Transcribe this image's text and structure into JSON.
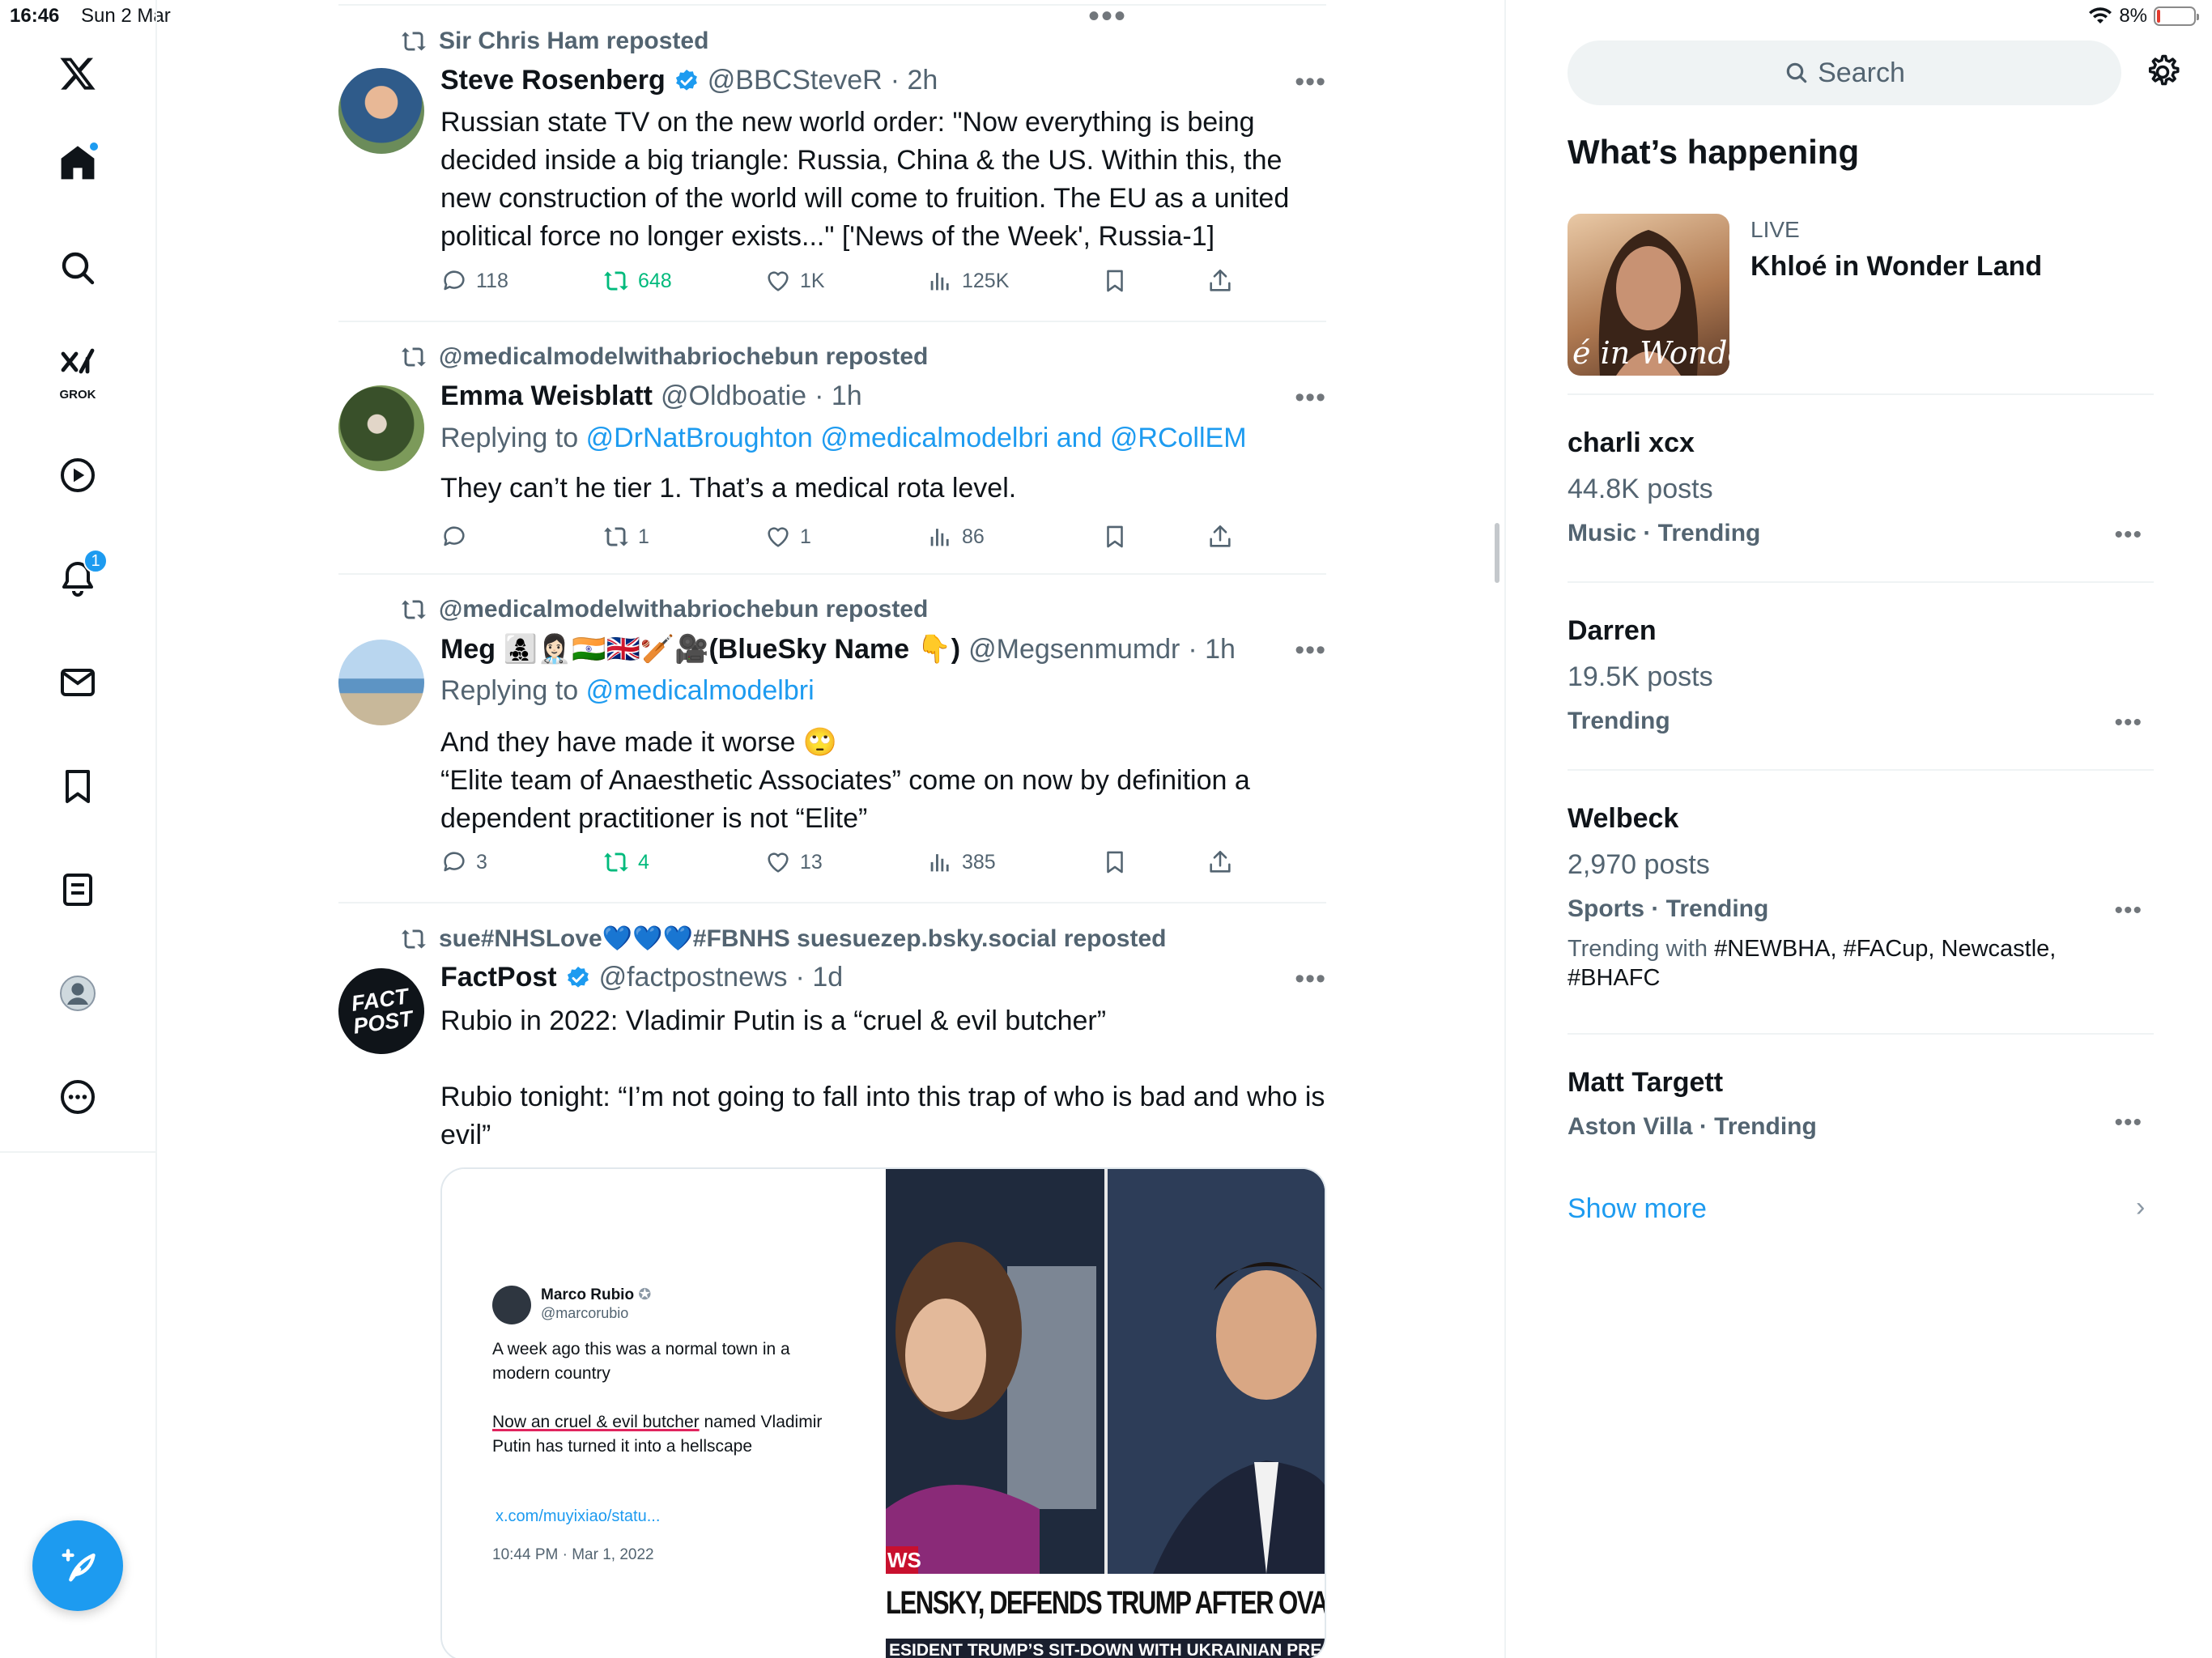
{
  "status_bar": {
    "time": "16:46",
    "date": "Sun 2 Mar",
    "battery": "8%",
    "battery_level": 0.08
  },
  "nav": {
    "items": [
      "x-logo",
      "home",
      "explore",
      "grok",
      "video",
      "notifications",
      "messages",
      "bookmarks",
      "lists",
      "profile",
      "more"
    ],
    "grok_label": "GROK",
    "notifications_badge": "1"
  },
  "timeline": {
    "tweets": [
      {
        "reposted_by": "Sir Chris Ham reposted",
        "name": "Steve Rosenberg",
        "verified": true,
        "handle": "@BBCSteveR",
        "time": "· 2h",
        "text": "Russian state TV on the new world order: \"Now everything is being decided inside a big triangle: Russia, China & the US. Within this, the new construction of the world will come to fruition. The EU as a united political force no longer exists...\" ['News of the Week', Russia-1]",
        "replies": "118",
        "reposts": "648",
        "likes": "1K",
        "views": "125K",
        "reposted": true
      },
      {
        "reposted_by": "@medicalmodelwithabriochebun reposted",
        "name": "Emma Weisblatt",
        "handle": "@Oldboatie",
        "time": "· 1h",
        "replying_prefix": "Replying to",
        "replying_to": "@DrNatBroughton @medicalmodelbri and @RCollEM",
        "text": "They can’t he tier 1. That’s a medical rota level.",
        "replies": "",
        "reposts": "1",
        "likes": "1",
        "views": "86"
      },
      {
        "reposted_by": "@medicalmodelwithabriochebun reposted",
        "name": "Meg 👩‍👧‍👦👩🏻‍⚕️🇮🇳🇬🇧🏏🎥(BlueSky Name 👇)",
        "handle": "@Megsenmumdr",
        "time": "· 1h",
        "replying_prefix": "Replying to",
        "replying_to": "@medicalmodelbri",
        "text_line1": "And they have made it worse 🙄",
        "text_line2": "“Elite team of Anaesthetic Associates” come on now by definition a dependent practitioner is not “Elite”",
        "replies": "3",
        "reposts": "4",
        "likes": "13",
        "views": "385",
        "reposted": true
      },
      {
        "reposted_by": "sue#NHSLove💙💙💙#FBNHS suesuezep.bsky.social reposted",
        "name": "FactPost",
        "verified": true,
        "handle": "@factpostnews",
        "time": "· 1d",
        "avatar_text_1": "FACT",
        "avatar_text_2": "POST",
        "text_line1": "Rubio in 2022: Vladimir Putin is a “cruel & evil butcher”",
        "text_line2": "Rubio tonight: “I’m not going to fall into this trap of who is bad and who is evil”",
        "media": {
          "embedded_name": "Marco Rubio",
          "embedded_handle": "@marcorubio",
          "embedded_text_1": "A week ago this was a normal town in a modern country",
          "embedded_text_2a": "Now an ",
          "embedded_text_2b": "cruel & evil butcher",
          "embedded_text_2c": " named Vladimir Putin has turned it into a hellscape",
          "embedded_link": "x.com/muyixiao/statu...",
          "embedded_date": "10:44 PM · Mar 1, 2022",
          "ticker_tag": "WS",
          "ticker_headline": "LENSKY, DEFENDS TRUMP AFTER OVAL OFFICE",
          "ticker_sub": "ESIDENT TRUMP’S SIT-DOWN WITH UKRAINIAN PRESI"
        }
      }
    ]
  },
  "sidebar": {
    "search_placeholder": "Search",
    "whats_happening": "What’s happening",
    "live": {
      "label": "LIVE",
      "title": "Khloé in Wonder Land",
      "thumb_text": "é in Wonder L"
    },
    "trends": [
      {
        "name": "charli xcx",
        "posts": "44.8K posts",
        "category": "Music · Trending"
      },
      {
        "name": "Darren",
        "posts": "19.5K posts",
        "category": "Trending"
      },
      {
        "name": "Welbeck",
        "posts": "2,970 posts",
        "category": "Sports · Trending",
        "trending_with_label": "Trending with ",
        "trending_with": "#NEWBHA, #FACup, Newcastle, #BHAFC"
      },
      {
        "name": "Matt Targett",
        "category": "Aston Villa · Trending"
      }
    ],
    "show_more": "Show more"
  },
  "colors": {
    "accent": "#1d9bf0",
    "repost_green": "#00ba7c",
    "text": "#0f1419",
    "muted": "#536471"
  }
}
